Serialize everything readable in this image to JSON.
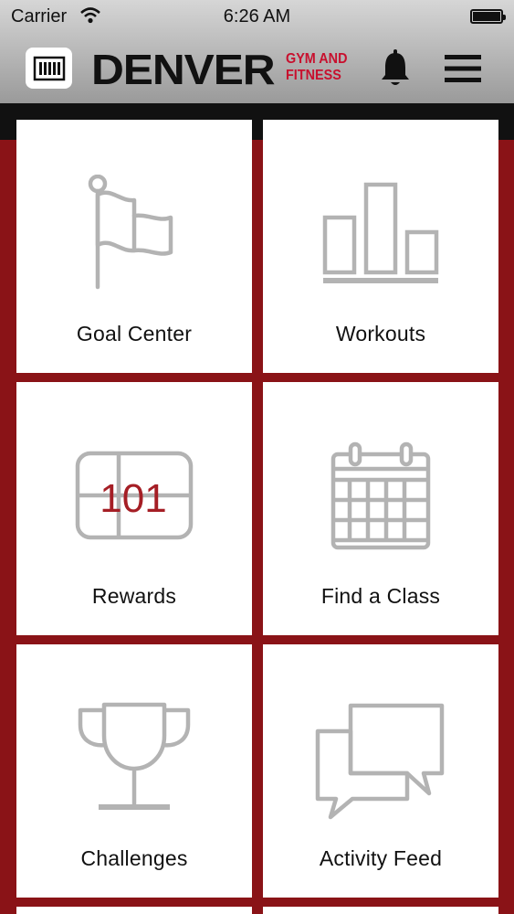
{
  "status_bar": {
    "carrier": "Carrier",
    "time": "6:26 AM"
  },
  "header": {
    "logo_main": "DENVER",
    "logo_sub_1": "GYM AND",
    "logo_sub_2": "FITNESS",
    "barcode_icon": "barcode-icon",
    "bell_icon": "bell-icon",
    "menu_icon": "hamburger-menu-icon"
  },
  "colors": {
    "brand_red": "#8a1317",
    "logo_red": "#c8102e",
    "icon_gray": "#b3b3b3"
  },
  "tiles": [
    {
      "label": "Goal Center",
      "icon": "flag-icon"
    },
    {
      "label": "Workouts",
      "icon": "bar-chart-icon"
    },
    {
      "label": "Rewards",
      "icon": "punch-card-icon",
      "icon_text": "101"
    },
    {
      "label": "Find a Class",
      "icon": "calendar-icon"
    },
    {
      "label": "Challenges",
      "icon": "trophy-icon"
    },
    {
      "label": "Activity Feed",
      "icon": "chat-bubbles-icon"
    }
  ]
}
